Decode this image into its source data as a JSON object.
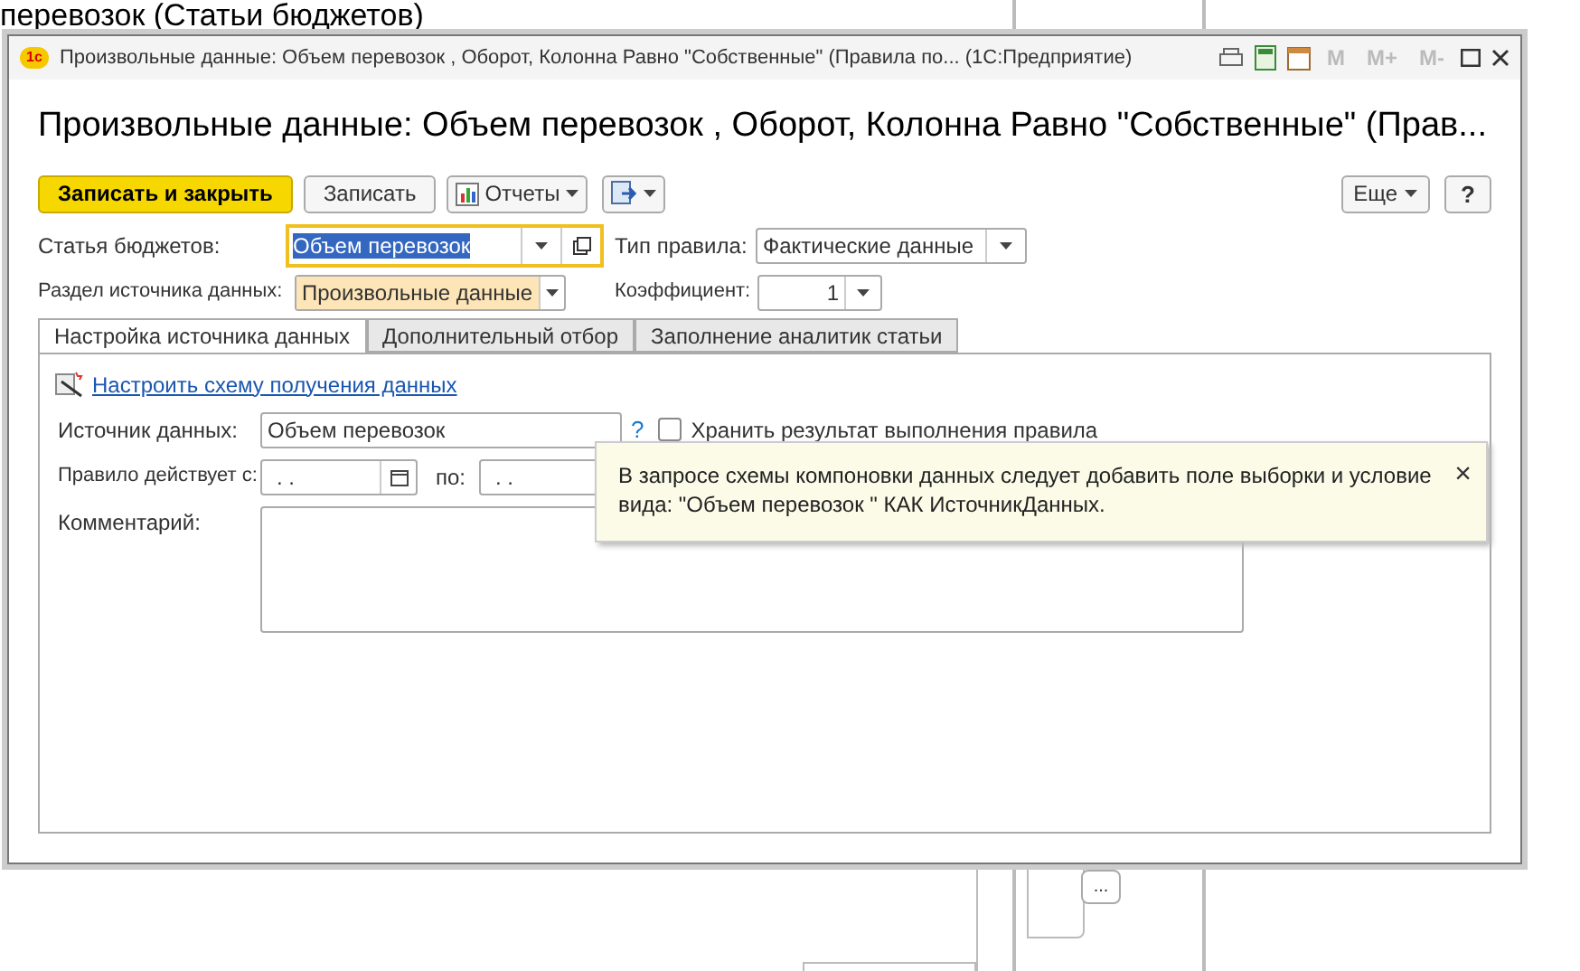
{
  "background": {
    "heading": "перевозок (Статьи бюджетов)",
    "ellipsis_button": "..."
  },
  "window": {
    "title": "Произвольные данные: Объем перевозок , Оборот, Колонна Равно \"Собственные\" (Правила по...  (1С:Предприятие)",
    "logo": "1с",
    "titlebar_buttons": [
      "M",
      "M+",
      "M-"
    ]
  },
  "form": {
    "heading": "Произвольные данные: Объем перевозок , Оборот, Колонна Равно \"Собственные\" (Прав...",
    "toolbar": {
      "buttons": [
        {
          "kind": "primary",
          "label": "Записать и закрыть"
        },
        {
          "kind": "plain",
          "label": "Записать"
        },
        {
          "kind": "menu",
          "label": "Отчеты"
        },
        {
          "kind": "icon-menu"
        }
      ],
      "more": "Еще",
      "help": "?"
    },
    "budget_item": {
      "label": "Статья бюджетов:",
      "value": "Объем перевозок",
      "focused": true
    },
    "rule_type": {
      "label": "Тип правила:",
      "value": "Фактические данные"
    },
    "source_section": {
      "label": "Раздел источника данных:",
      "value": "Произвольные данные"
    },
    "coefficient": {
      "label": "Коэффициент:",
      "value": "1"
    },
    "tabs": [
      {
        "label": "Настройка источника данных",
        "selected": true
      },
      {
        "label": "Дополнительный отбор",
        "selected": false
      },
      {
        "label": "Заполнение аналитик статьи",
        "selected": false
      }
    ],
    "configure_link": "Настроить схему получения данных",
    "data_source": {
      "label": "Источник данных:",
      "value": "Объем перевозок",
      "help": "?"
    },
    "store_result": {
      "label": "Хранить результат выполнения правила",
      "checked": false
    },
    "period": {
      "label": "Правило действует с:",
      "from": ". .",
      "to_label": "по:",
      "to": ". ."
    },
    "comment": {
      "label": "Комментарий:"
    },
    "tooltip": {
      "text": "В запросе схемы компоновки данных следует добавить поле выборки и условие вида: \"Объем перевозок \" КАК ИсточникДанных.",
      "close": "×"
    }
  }
}
